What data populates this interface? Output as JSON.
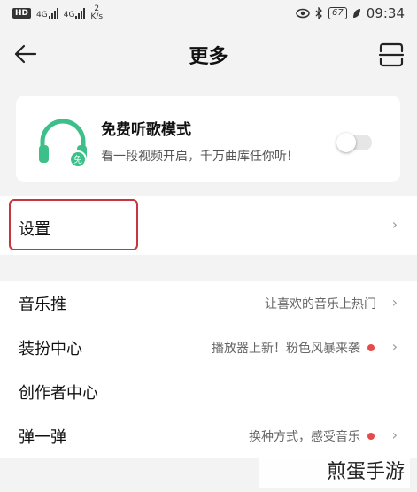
{
  "status_bar": {
    "network_badge": "HD",
    "signal1_type": "4G",
    "signal2_type": "4G",
    "speed_value": "2",
    "speed_unit": "K/s",
    "battery": "67",
    "time": "09:34"
  },
  "header": {
    "title": "更多"
  },
  "promo_card": {
    "title": "免费听歌模式",
    "subtitle": "看一段视频开启，千万曲库任你听!",
    "toggle_on": false,
    "accent_color": "#3dbf8a"
  },
  "settings": {
    "label": "设置",
    "chevron": "›"
  },
  "list": [
    {
      "label": "音乐推",
      "hint": "让喜欢的音乐上热门",
      "dot": false,
      "chevron": "›"
    },
    {
      "label": "装扮中心",
      "hint": "播放器上新！粉色风暴来袭",
      "dot": true,
      "chevron": "›"
    },
    {
      "label": "创作者中心",
      "hint": "",
      "dot": false,
      "chevron": ""
    },
    {
      "label": "弹一弹",
      "hint": "换种方式，感受音乐",
      "dot": true,
      "chevron": "›"
    }
  ],
  "watermark": "煎蛋手游",
  "colors": {
    "highlight": "#c9353c",
    "red_dot": "#e74a4a"
  }
}
